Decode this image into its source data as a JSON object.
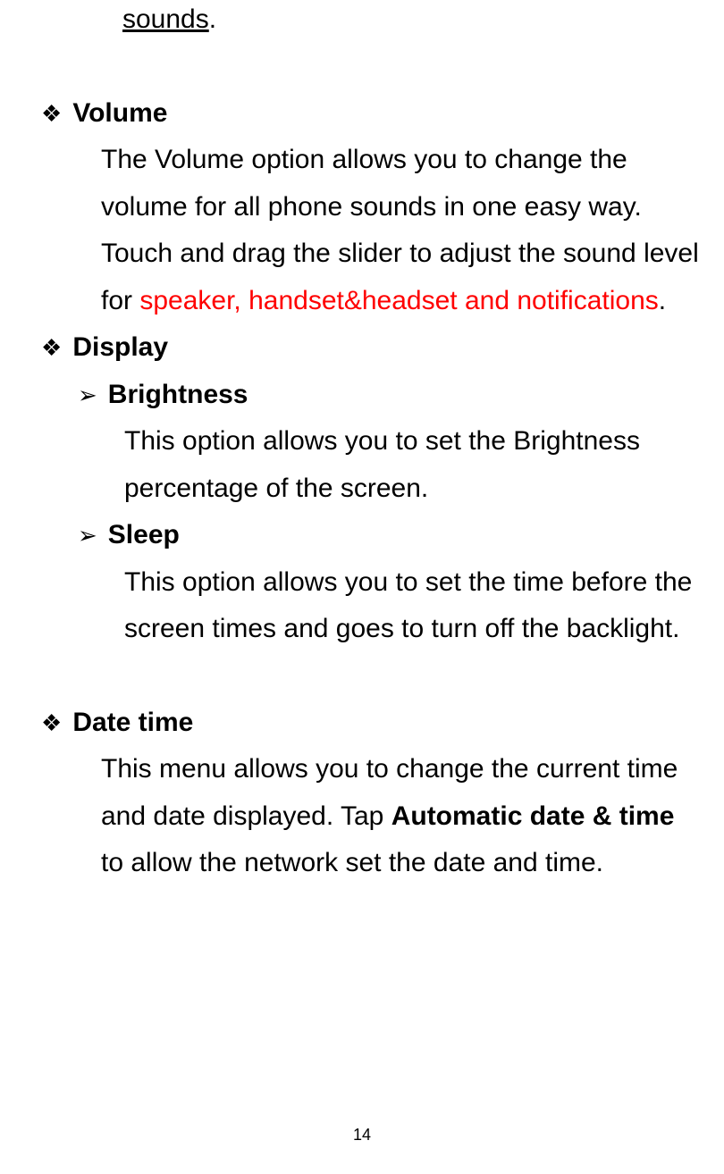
{
  "topLine": "sounds",
  "topLinePeriod": ".",
  "volume": {
    "title": "Volume",
    "body_part1": "The Volume option allows you to change the volume for all phone sounds in one easy way. Touch and drag the slider to adjust the sound level for ",
    "body_red": "speaker, handset&headset and notifications",
    "body_part2": "."
  },
  "display": {
    "title": "Display",
    "brightness": {
      "title": "Brightness",
      "body": "This option allows you to set the Brightness percentage of the screen."
    },
    "sleep": {
      "title": "Sleep",
      "body": "This option allows you to set the time before the screen times and goes to turn off the backlight."
    }
  },
  "datetime": {
    "title": "Date time",
    "body_part1": "This menu allows you to change the current time and date displayed. Tap ",
    "body_bold": "Automatic date & time",
    "body_part2": " to allow the network set the date and time."
  },
  "pageNumber": "14"
}
